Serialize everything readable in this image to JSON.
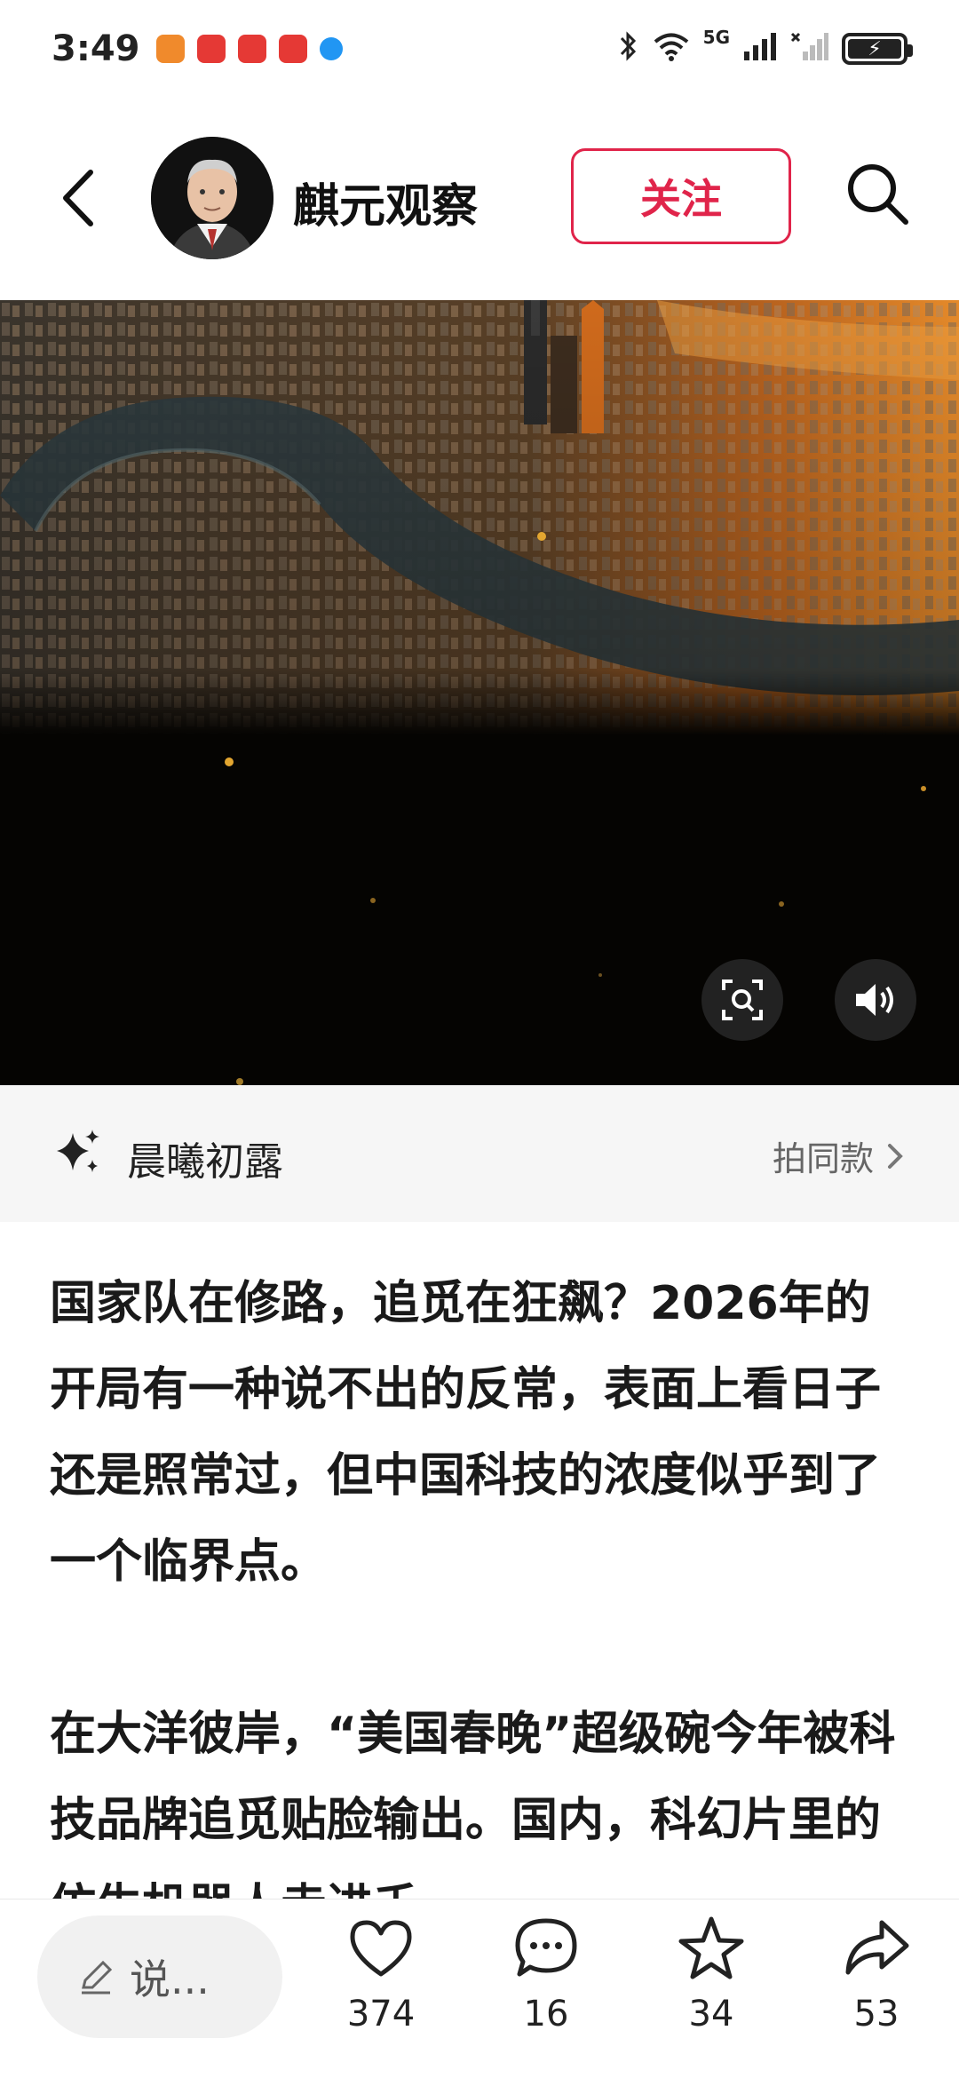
{
  "status_bar": {
    "time": "3:49",
    "network": "5G",
    "app_icon_colors": [
      "#f08a2c",
      "#e53935",
      "#e53935",
      "#e53935",
      "#2196f3"
    ]
  },
  "header": {
    "author_name": "麒元观察",
    "follow_label": "关注"
  },
  "music": {
    "title": "晨曦初露",
    "same_style_label": "拍同款"
  },
  "article": {
    "paragraphs": [
      "国家队在修路，追觅在狂飙？2026年的开局有一种说不出的反常，表面上看日子还是照常过，但中国科技的浓度似乎到了一个临界点。",
      "在大洋彼岸，“美国春晚”超级碗今年被科技品牌追觅贴脸输出。国内，科幻片里的仿生机器人走进千"
    ]
  },
  "bottom_bar": {
    "comment_placeholder": "说...",
    "like_count": "374",
    "comment_count": "16",
    "favorite_count": "34",
    "share_count": "53"
  },
  "colors": {
    "accent": "#e0244a"
  }
}
